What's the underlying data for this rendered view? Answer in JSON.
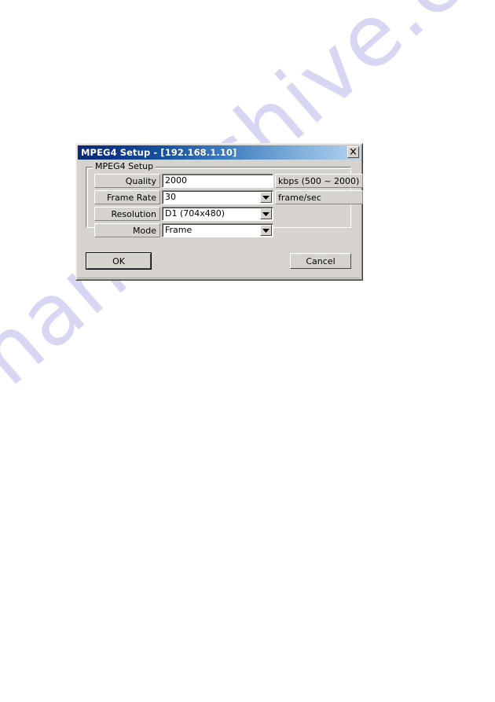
{
  "page": {
    "background_color": "#ffffff",
    "watermark": "manualshive.com",
    "watermark_color": "#c9c8ef"
  },
  "dialog": {
    "title": "MPEG4 Setup - [192.168.1.10]",
    "titlebar_gradient_start": "#0a2a74",
    "titlebar_gradient_end": "#b6d4ef",
    "face_color": "#d6d3ce",
    "close_icon": "close-icon",
    "groupbox": {
      "legend": "MPEG4 Setup",
      "fields": [
        {
          "label": "Quality",
          "value": "2000",
          "control": "textbox",
          "unit": "kbps (500 ~ 2000)"
        },
        {
          "label": "Frame Rate",
          "value": "30",
          "control": "combobox",
          "unit": "frame/sec"
        },
        {
          "label": "Resolution",
          "value": "D1 (704x480)",
          "control": "combobox",
          "unit": ""
        },
        {
          "label": "Mode",
          "value": "Frame",
          "control": "combobox",
          "unit": ""
        }
      ]
    },
    "buttons": {
      "ok": "OK",
      "cancel": "Cancel"
    }
  }
}
